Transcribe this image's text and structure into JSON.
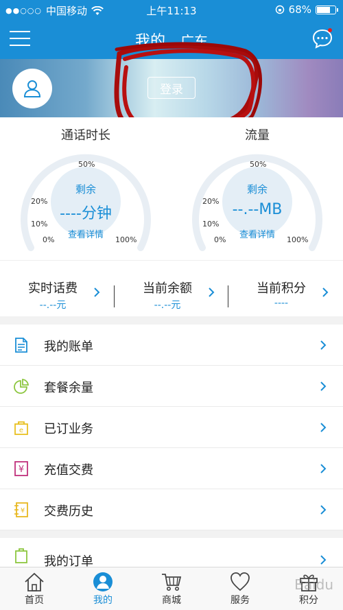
{
  "status_bar": {
    "carrier": "中国移动",
    "time": "上午11:13",
    "battery": "68%"
  },
  "nav": {
    "title": "我的",
    "region": "广东"
  },
  "banner": {
    "login_label": "登录"
  },
  "meters": [
    {
      "title": "通话时长",
      "remain_label": "剩余",
      "value": "----分钟",
      "detail_label": "查看详情",
      "ticks": [
        "50%",
        "20%",
        "10%",
        "0%",
        "100%"
      ]
    },
    {
      "title": "流量",
      "remain_label": "剩余",
      "value": "--.--MB",
      "detail_label": "查看详情",
      "ticks": [
        "50%",
        "20%",
        "10%",
        "0%",
        "100%"
      ]
    }
  ],
  "balances": [
    {
      "title": "实时话费",
      "value": "--.--元"
    },
    {
      "title": "当前余额",
      "value": "--.--元"
    },
    {
      "title": "当前积分",
      "value": "----"
    }
  ],
  "menu": [
    {
      "label": "我的账单",
      "icon": "bill-icon",
      "color": "#1a8ed6"
    },
    {
      "label": "套餐余量",
      "icon": "pie-chart-icon",
      "color": "#8cc63f"
    },
    {
      "label": "已订业务",
      "icon": "subscribed-bag-icon",
      "color": "#e8c020"
    },
    {
      "label": "充值交费",
      "icon": "yuan-recharge-icon",
      "color": "#c0307c"
    },
    {
      "label": "交费历史",
      "icon": "payment-history-icon",
      "color": "#e8b820"
    }
  ],
  "menu2": [
    {
      "label": "我的订单",
      "icon": "order-icon",
      "color": "#8cc63f"
    }
  ],
  "tabs": [
    {
      "label": "首页",
      "icon": "home-icon"
    },
    {
      "label": "我的",
      "icon": "person-icon"
    },
    {
      "label": "商城",
      "icon": "cart-icon"
    },
    {
      "label": "服务",
      "icon": "heart-icon"
    },
    {
      "label": "积分",
      "icon": "gift-icon"
    }
  ],
  "colors": {
    "accent": "#1a8ed6",
    "scribble": "#b01010"
  }
}
